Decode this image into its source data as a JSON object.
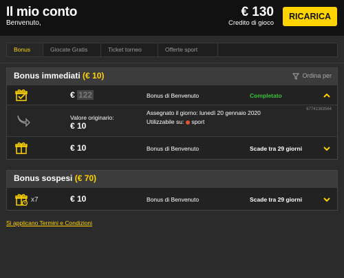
{
  "header": {
    "title": "Il mio conto",
    "welcome": "Benvenuto,",
    "balance": "€ 130",
    "balance_label": "Credito di gioco",
    "recharge_label": "RICARICA"
  },
  "tabs": [
    {
      "label": "Bonus",
      "active": true
    },
    {
      "label": "Giocate Gratis",
      "active": false
    },
    {
      "label": "Ticket torneo",
      "active": false
    },
    {
      "label": "Offerte sport",
      "active": false
    }
  ],
  "immediate": {
    "title": "Bonus immediati",
    "amount": "(€ 10)",
    "sort_label": "Ordina per",
    "rows": [
      {
        "amount_prefix": "€",
        "amount_hidden": "122",
        "name": "Bonus di Benvenuto",
        "status": "Completato",
        "expanded": {
          "original_label": "Valore originario:",
          "original_value": "€ 10",
          "assigned": "Assegnato il giorno: lunedì 20 gennaio 2020",
          "usable_label": "Utilizzabile su:",
          "usable_value": "sport",
          "ticket_id": "67741383564"
        }
      },
      {
        "amount": "€ 10",
        "name": "Bonus di Benvenuto",
        "status": "Scade tra 29 giorni"
      }
    ]
  },
  "pending": {
    "title": "Bonus sospesi",
    "amount": "(€ 70)",
    "rows": [
      {
        "multiplier": "x7",
        "amount": "€ 10",
        "name": "Bonus di Benvenuto",
        "status": "Scade tra 29 giorni"
      }
    ]
  },
  "terms_label": "Si applicano Termini e Condizioni",
  "colors": {
    "accent": "#ffd400",
    "completed": "#39c33a",
    "sport": "#e8512a",
    "background": "#2b2b2b"
  },
  "icons": [
    "gift-icon",
    "gift-check-icon",
    "gift-clock-icon",
    "chevron-up-icon",
    "chevron-down-icon",
    "filter-icon",
    "arrow-icon"
  ]
}
